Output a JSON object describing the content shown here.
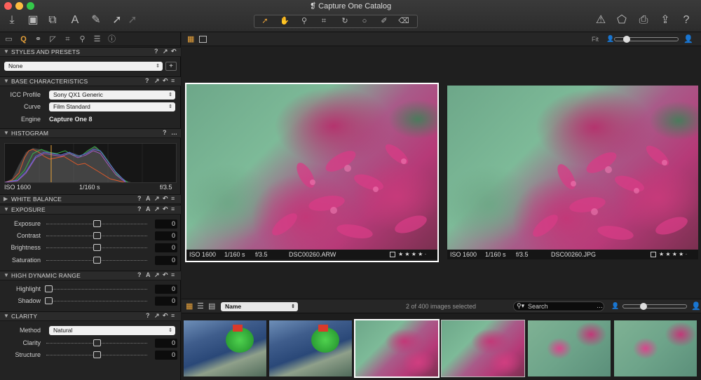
{
  "window": {
    "title": "Capture One Catalog",
    "title_icon": "catalog-icon"
  },
  "toolbar": {
    "left_icons": [
      "import-icon",
      "capture-icon",
      "live-view-icon",
      "text-tool-icon",
      "brush-icon",
      "cursor-arrow-icon",
      "cursor-arrow-dim-icon"
    ],
    "cursor_tools": [
      "select-arrow",
      "hand",
      "loupe",
      "crop",
      "rotate",
      "circle",
      "picker",
      "eraser"
    ],
    "right_icons": [
      "warning-icon",
      "process-icon",
      "print-icon",
      "export-icon",
      "help-icon"
    ],
    "help_label": "?"
  },
  "tool_tabs": [
    "folder-icon",
    "capture-tab-icon",
    "color-icon",
    "exposure-icon",
    "crop-icon",
    "detail-icon",
    "metadata-icon",
    "info-icon"
  ],
  "styles": {
    "header": "STYLES AND PRESETS",
    "value": "None",
    "add_label": "+"
  },
  "base": {
    "header": "BASE CHARACTERISTICS",
    "icc_label": "ICC Profile",
    "icc_value": "Sony QX1 Generic",
    "curve_label": "Curve",
    "curve_value": "Film Standard",
    "engine_label": "Engine",
    "engine_value": "Capture One 8"
  },
  "histogram": {
    "header": "HISTOGRAM",
    "iso": "ISO 1600",
    "shutter": "1/160 s",
    "aperture": "f/3.5"
  },
  "white_balance": {
    "header": "WHITE BALANCE"
  },
  "exposure": {
    "header": "EXPOSURE",
    "rows": [
      {
        "label": "Exposure",
        "value": "0"
      },
      {
        "label": "Contrast",
        "value": "0"
      },
      {
        "label": "Brightness",
        "value": "0"
      },
      {
        "label": "Saturation",
        "value": "0"
      }
    ]
  },
  "hdr": {
    "header": "HIGH DYNAMIC RANGE",
    "rows": [
      {
        "label": "Highlight",
        "value": "0"
      },
      {
        "label": "Shadow",
        "value": "0"
      }
    ]
  },
  "clarity": {
    "header": "CLARITY",
    "method_label": "Method",
    "method_value": "Natural",
    "rows": [
      {
        "label": "Clarity",
        "value": "0"
      },
      {
        "label": "Structure",
        "value": "0"
      }
    ]
  },
  "header_icons": {
    "help": "?",
    "auto": "A"
  },
  "viewer": {
    "fit_label": "Fit",
    "zoom_level": 0.15,
    "left_photo": {
      "iso": "ISO 1600",
      "shutter": "1/160 s",
      "aperture": "f/3.5",
      "filename": "DSC00260.ARW",
      "stars": "★ ★ ★ ★ ·"
    },
    "right_photo": {
      "iso": "ISO 1600",
      "shutter": "1/160 s",
      "aperture": "f/3.5",
      "filename": "DSC00260.JPG",
      "stars": "★ ★ ★ ★ ·"
    }
  },
  "browser": {
    "sort_value": "Name",
    "selection_status": "2 of 400 images selected",
    "search_placeholder": "Search",
    "thumb_zoom_level": 0.3
  },
  "colors": {
    "accent": "#e8a23a",
    "panel": "#232323",
    "selected_border": "#ffffff"
  }
}
